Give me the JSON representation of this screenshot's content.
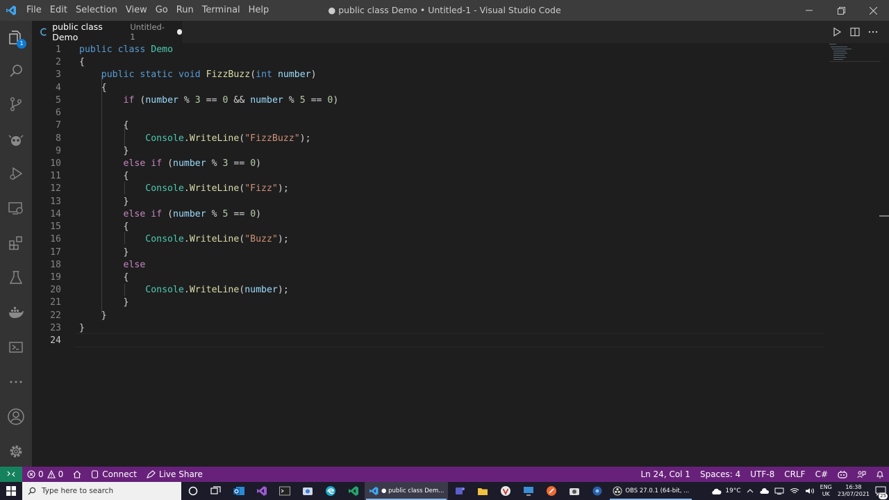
{
  "window": {
    "title": "● public class Demo • Untitled-1 - Visual Studio Code",
    "menu": [
      "File",
      "Edit",
      "Selection",
      "View",
      "Go",
      "Run",
      "Terminal",
      "Help"
    ]
  },
  "activity_bar": {
    "items": [
      "explorer-icon",
      "search-icon",
      "source-control-icon",
      "debug-alt-icon",
      "run-debug-icon",
      "remote-explorer-icon",
      "extensions-icon",
      "testing-icon",
      "docker-icon",
      "powershell-icon",
      "more-icon"
    ],
    "explorer_badge": "1",
    "bottom": [
      "accounts-icon",
      "manage-gear-icon"
    ]
  },
  "tab": {
    "title": "public class Demo",
    "description": "Untitled-1"
  },
  "editor": {
    "lines": [
      {
        "n": "1",
        "segs": [
          [
            "kw",
            "public"
          ],
          [
            "",
            " "
          ],
          [
            "kw",
            "class"
          ],
          [
            "",
            " "
          ],
          [
            "ty",
            "Demo"
          ]
        ]
      },
      {
        "n": "2",
        "segs": [
          [
            "",
            "{"
          ]
        ]
      },
      {
        "n": "3",
        "segs": [
          [
            "",
            "    "
          ],
          [
            "kw",
            "public"
          ],
          [
            "",
            " "
          ],
          [
            "kw",
            "static"
          ],
          [
            "",
            " "
          ],
          [
            "kw",
            "void"
          ],
          [
            "",
            " "
          ],
          [
            "fn",
            "FizzBuzz"
          ],
          [
            "",
            "("
          ],
          [
            "kw",
            "int"
          ],
          [
            "",
            " "
          ],
          [
            "vr",
            "number"
          ],
          [
            "",
            ")"
          ]
        ]
      },
      {
        "n": "4",
        "segs": [
          [
            "",
            "    {"
          ]
        ]
      },
      {
        "n": "5",
        "segs": [
          [
            "",
            "        "
          ],
          [
            "ctl",
            "if"
          ],
          [
            "",
            " ("
          ],
          [
            "vr",
            "number"
          ],
          [
            "",
            " % "
          ],
          [
            "nm",
            "3"
          ],
          [
            "",
            " == "
          ],
          [
            "nm",
            "0"
          ],
          [
            "",
            " && "
          ],
          [
            "vr",
            "number"
          ],
          [
            "",
            " % "
          ],
          [
            "nm",
            "5"
          ],
          [
            "",
            " == "
          ],
          [
            "nm",
            "0"
          ],
          [
            "",
            ")"
          ]
        ]
      },
      {
        "n": "6",
        "segs": []
      },
      {
        "n": "7",
        "segs": [
          [
            "",
            "        {"
          ]
        ]
      },
      {
        "n": "8",
        "segs": [
          [
            "",
            "            "
          ],
          [
            "ty",
            "Console"
          ],
          [
            "",
            "."
          ],
          [
            "fn",
            "WriteLine"
          ],
          [
            "",
            "("
          ],
          [
            "st",
            "\"FizzBuzz\""
          ],
          [
            "",
            ");"
          ]
        ]
      },
      {
        "n": "9",
        "segs": [
          [
            "",
            "        }"
          ]
        ]
      },
      {
        "n": "10",
        "segs": [
          [
            "",
            "        "
          ],
          [
            "ctl",
            "else"
          ],
          [
            "",
            " "
          ],
          [
            "ctl",
            "if"
          ],
          [
            "",
            " ("
          ],
          [
            "vr",
            "number"
          ],
          [
            "",
            " % "
          ],
          [
            "nm",
            "3"
          ],
          [
            "",
            " == "
          ],
          [
            "nm",
            "0"
          ],
          [
            "",
            ")"
          ]
        ]
      },
      {
        "n": "11",
        "segs": [
          [
            "",
            "        {"
          ]
        ]
      },
      {
        "n": "12",
        "segs": [
          [
            "",
            "            "
          ],
          [
            "ty",
            "Console"
          ],
          [
            "",
            "."
          ],
          [
            "fn",
            "WriteLine"
          ],
          [
            "",
            "("
          ],
          [
            "st",
            "\"Fizz\""
          ],
          [
            "",
            ");"
          ]
        ]
      },
      {
        "n": "13",
        "segs": [
          [
            "",
            "        }"
          ]
        ]
      },
      {
        "n": "14",
        "segs": [
          [
            "",
            "        "
          ],
          [
            "ctl",
            "else"
          ],
          [
            "",
            " "
          ],
          [
            "ctl",
            "if"
          ],
          [
            "",
            " ("
          ],
          [
            "vr",
            "number"
          ],
          [
            "",
            " % "
          ],
          [
            "nm",
            "5"
          ],
          [
            "",
            " == "
          ],
          [
            "nm",
            "0"
          ],
          [
            "",
            ")"
          ]
        ]
      },
      {
        "n": "15",
        "segs": [
          [
            "",
            "        {"
          ]
        ]
      },
      {
        "n": "16",
        "segs": [
          [
            "",
            "            "
          ],
          [
            "ty",
            "Console"
          ],
          [
            "",
            "."
          ],
          [
            "fn",
            "WriteLine"
          ],
          [
            "",
            "("
          ],
          [
            "st",
            "\"Buzz\""
          ],
          [
            "",
            ");"
          ]
        ]
      },
      {
        "n": "17",
        "segs": [
          [
            "",
            "        }"
          ]
        ]
      },
      {
        "n": "18",
        "segs": [
          [
            "",
            "        "
          ],
          [
            "ctl",
            "else"
          ]
        ]
      },
      {
        "n": "19",
        "segs": [
          [
            "",
            "        {"
          ]
        ]
      },
      {
        "n": "20",
        "segs": [
          [
            "",
            "            "
          ],
          [
            "ty",
            "Console"
          ],
          [
            "",
            "."
          ],
          [
            "fn",
            "WriteLine"
          ],
          [
            "",
            "("
          ],
          [
            "vr",
            "number"
          ],
          [
            "",
            ");"
          ]
        ]
      },
      {
        "n": "21",
        "segs": [
          [
            "",
            "        }"
          ]
        ]
      },
      {
        "n": "22",
        "segs": [
          [
            "",
            "    }"
          ]
        ]
      },
      {
        "n": "23",
        "segs": [
          [
            "",
            "}"
          ]
        ]
      },
      {
        "n": "24",
        "segs": []
      }
    ],
    "active_line": "24"
  },
  "status_bar": {
    "errors": "0",
    "warnings": "0",
    "connect": "Connect",
    "live_share": "Live Share",
    "position": "Ln 24, Col 1",
    "spaces": "Spaces: 4",
    "encoding": "UTF-8",
    "eol": "CRLF",
    "language": "C#"
  },
  "taskbar": {
    "search_placeholder": "Type here to search",
    "vscode_window": "● public class Dem...",
    "obs_window": "OBS 27.0.1 (64-bit, ...",
    "weather": "19°C",
    "lang_top": "ENG",
    "lang_bottom": "UK",
    "time": "16:38",
    "date": "23/07/2021",
    "notifications": "25"
  },
  "colors": {
    "statusbar": "#68217a",
    "remote": "#16825d",
    "editor_bg": "#1e1e1e",
    "activity_bar": "#333333"
  }
}
